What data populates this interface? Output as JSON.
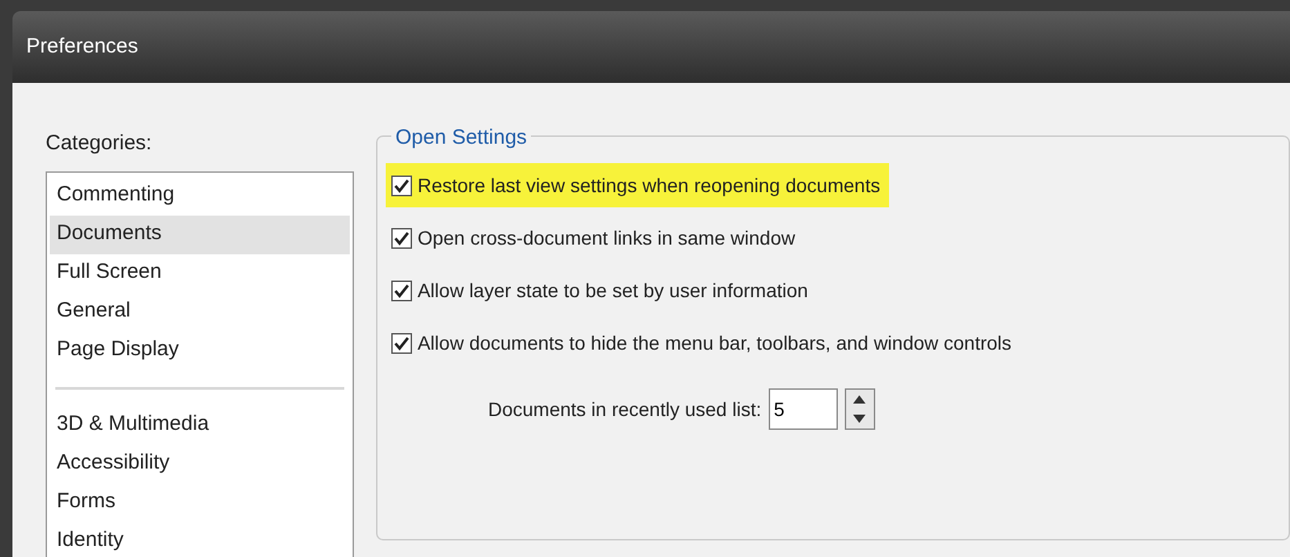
{
  "window": {
    "title": "Preferences"
  },
  "categories": {
    "label": "Categories:",
    "groups": [
      [
        {
          "label": "Commenting",
          "selected": false
        },
        {
          "label": "Documents",
          "selected": true
        },
        {
          "label": "Full Screen",
          "selected": false
        },
        {
          "label": "General",
          "selected": false
        },
        {
          "label": "Page Display",
          "selected": false
        }
      ],
      [
        {
          "label": "3D & Multimedia",
          "selected": false
        },
        {
          "label": "Accessibility",
          "selected": false
        },
        {
          "label": "Forms",
          "selected": false
        },
        {
          "label": "Identity",
          "selected": false
        }
      ]
    ]
  },
  "open_settings": {
    "title": "Open Settings",
    "options": [
      {
        "label": "Restore last view settings when reopening documents",
        "checked": true,
        "highlighted": true
      },
      {
        "label": "Open cross-document links in same window",
        "checked": true,
        "highlighted": false
      },
      {
        "label": "Allow layer state to be set by user information",
        "checked": true,
        "highlighted": false
      },
      {
        "label": "Allow documents to hide the menu bar, toolbars, and window controls",
        "checked": true,
        "highlighted": false
      }
    ],
    "recent_list": {
      "label": "Documents in recently used list:",
      "value": "5"
    }
  }
}
